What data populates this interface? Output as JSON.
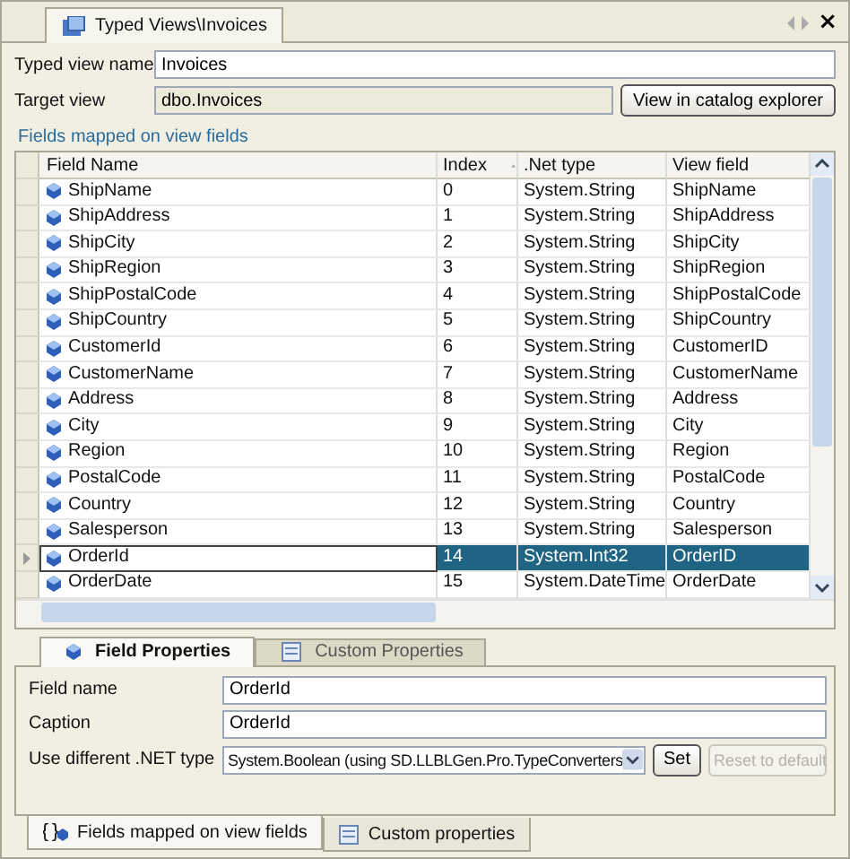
{
  "document_tab": {
    "title": "Typed Views\\Invoices",
    "close": "×"
  },
  "form": {
    "name_label": "Typed view name",
    "name_value": "Invoices",
    "target_label": "Target view",
    "target_value": "dbo.Invoices",
    "catalog_button": "View in catalog explorer"
  },
  "group_title": "Fields mapped on view fields",
  "table": {
    "columns": [
      {
        "label": "Field Name",
        "sorted": false
      },
      {
        "label": "Index",
        "sorted": true
      },
      {
        "label": ".Net type",
        "sorted": false
      },
      {
        "label": "View field",
        "sorted": false
      }
    ],
    "rows": [
      {
        "cells": [
          "ShipName",
          "0",
          "System.String",
          "ShipName"
        ],
        "selected": false
      },
      {
        "cells": [
          "ShipAddress",
          "1",
          "System.String",
          "ShipAddress"
        ],
        "selected": false
      },
      {
        "cells": [
          "ShipCity",
          "2",
          "System.String",
          "ShipCity"
        ],
        "selected": false
      },
      {
        "cells": [
          "ShipRegion",
          "3",
          "System.String",
          "ShipRegion"
        ],
        "selected": false
      },
      {
        "cells": [
          "ShipPostalCode",
          "4",
          "System.String",
          "ShipPostalCode"
        ],
        "selected": false
      },
      {
        "cells": [
          "ShipCountry",
          "5",
          "System.String",
          "ShipCountry"
        ],
        "selected": false
      },
      {
        "cells": [
          "CustomerId",
          "6",
          "System.String",
          "CustomerID"
        ],
        "selected": false
      },
      {
        "cells": [
          "CustomerName",
          "7",
          "System.String",
          "CustomerName"
        ],
        "selected": false
      },
      {
        "cells": [
          "Address",
          "8",
          "System.String",
          "Address"
        ],
        "selected": false
      },
      {
        "cells": [
          "City",
          "9",
          "System.String",
          "City"
        ],
        "selected": false
      },
      {
        "cells": [
          "Region",
          "10",
          "System.String",
          "Region"
        ],
        "selected": false
      },
      {
        "cells": [
          "PostalCode",
          "11",
          "System.String",
          "PostalCode"
        ],
        "selected": false
      },
      {
        "cells": [
          "Country",
          "12",
          "System.String",
          "Country"
        ],
        "selected": false
      },
      {
        "cells": [
          "Salesperson",
          "13",
          "System.String",
          "Salesperson"
        ],
        "selected": false
      },
      {
        "cells": [
          "OrderId",
          "14",
          "System.Int32",
          "OrderID"
        ],
        "selected": true
      },
      {
        "cells": [
          "OrderDate",
          "15",
          "System.DateTime",
          "OrderDate"
        ],
        "selected": false
      }
    ]
  },
  "property_tabs": [
    {
      "label": "Field Properties",
      "kind": "field",
      "selected": true
    },
    {
      "label": "Custom Properties",
      "kind": "custom",
      "selected": false
    }
  ],
  "properties": {
    "field_name_label": "Field name",
    "field_name_value": "OrderId",
    "caption_label": "Caption",
    "caption_value": "OrderId",
    "type_label": "Use different .NET type",
    "type_value": "System.Boolean (using SD.LLBLGen.Pro.TypeConverters",
    "set_button": "Set",
    "reset_button": {
      "label": "Reset to default",
      "disabled": true
    }
  },
  "bottom_tabs": [
    {
      "label": "Fields mapped on view fields",
      "kind": "fields",
      "selected": true
    },
    {
      "label": "Custom properties",
      "kind": "custom",
      "selected": false
    }
  ]
}
